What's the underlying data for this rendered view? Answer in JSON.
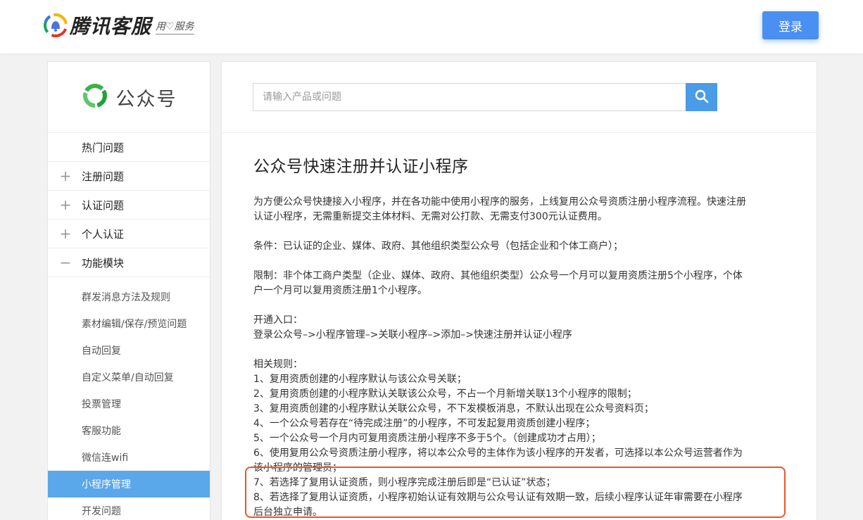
{
  "header": {
    "logo_text": "腾讯客服",
    "logo_slogan": "用♡服务",
    "login_label": "登录"
  },
  "sidebar": {
    "brand": "公众号",
    "menu": [
      {
        "label": "热门问题",
        "sign": ""
      },
      {
        "label": "注册问题",
        "sign": "+"
      },
      {
        "label": "认证问题",
        "sign": "+"
      },
      {
        "label": "个人认证",
        "sign": "+"
      },
      {
        "label": "功能模块",
        "sign": "−"
      }
    ],
    "sub_items": [
      {
        "label": "群发消息方法及规则"
      },
      {
        "label": "素材编辑/保存/预览问题"
      },
      {
        "label": "自动回复"
      },
      {
        "label": "自定义菜单/自动回复"
      },
      {
        "label": "投票管理"
      },
      {
        "label": "客服功能"
      },
      {
        "label": "微信连wifi"
      },
      {
        "label": "小程序管理"
      },
      {
        "label": "开发问题"
      }
    ],
    "active_sub": "小程序管理"
  },
  "search": {
    "placeholder": "请输入产品或问题"
  },
  "article": {
    "title": "公众号快速注册并认证小程序",
    "intro_1": "为方便公众号快捷接入小程序，并在各功能中使用小程序的服务，上线复用公众号资质注册小程序流程。快速注册",
    "intro_2": "认证小程序，无需重新提交主体材料、无需对公打款、无需支付300元认证费用。",
    "condition": "条件：已认证的企业、媒体、政府、其他组织类型公众号（包括企业和个体工商户）；",
    "limit_1": "限制：非个体工商户类型（企业、媒体、政府、其他组织类型）公众号一个月可以复用资质注册5个小程序，个体",
    "limit_2": "户一个月可以复用资质注册1个小程序。",
    "entry_heading": "开通入口：",
    "entry_path": "登录公众号–>小程序管理–>关联小程序–>添加–>快速注册并认证小程序",
    "rules_heading": "相关规则：",
    "rule_1": "1、复用资质创建的小程序默认与该公众号关联；",
    "rule_2": "2、复用资质创建的小程序默认关联该公众号，不占一个月新增关联13个小程序的限制；",
    "rule_3": "3、复用资质创建的小程序默认关联公众号，不下发模板消息，不默认出现在公众号资料页；",
    "rule_4": "4、一个公众号若存在“待完成注册”的小程序，不可发起复用资质创建小程序；",
    "rule_5": "5、一个公众号一个月内可复用资质注册小程序不多于5个。（创建成功才占用）；",
    "rule_6a": "6、使用复用公众号资质注册小程序，将以本公众号的主体作为该小程序的开发者，可选择以本公众号运营者作为",
    "rule_6b": "该小程序的管理员；",
    "rule_7": "7、若选择了复用认证资质，则小程序完成注册后即是“已认证”状态；",
    "rule_8a": "8、若选择了复用认证资质，小程序初始认证有效期与公众号认证有效期一致，后续小程序认证年审需要在小程序",
    "rule_8b": "后台独立申请。"
  },
  "colors": {
    "accent": "#4a8ff2",
    "active_item": "#5aa7ea",
    "highlight_border": "#e8552a"
  }
}
